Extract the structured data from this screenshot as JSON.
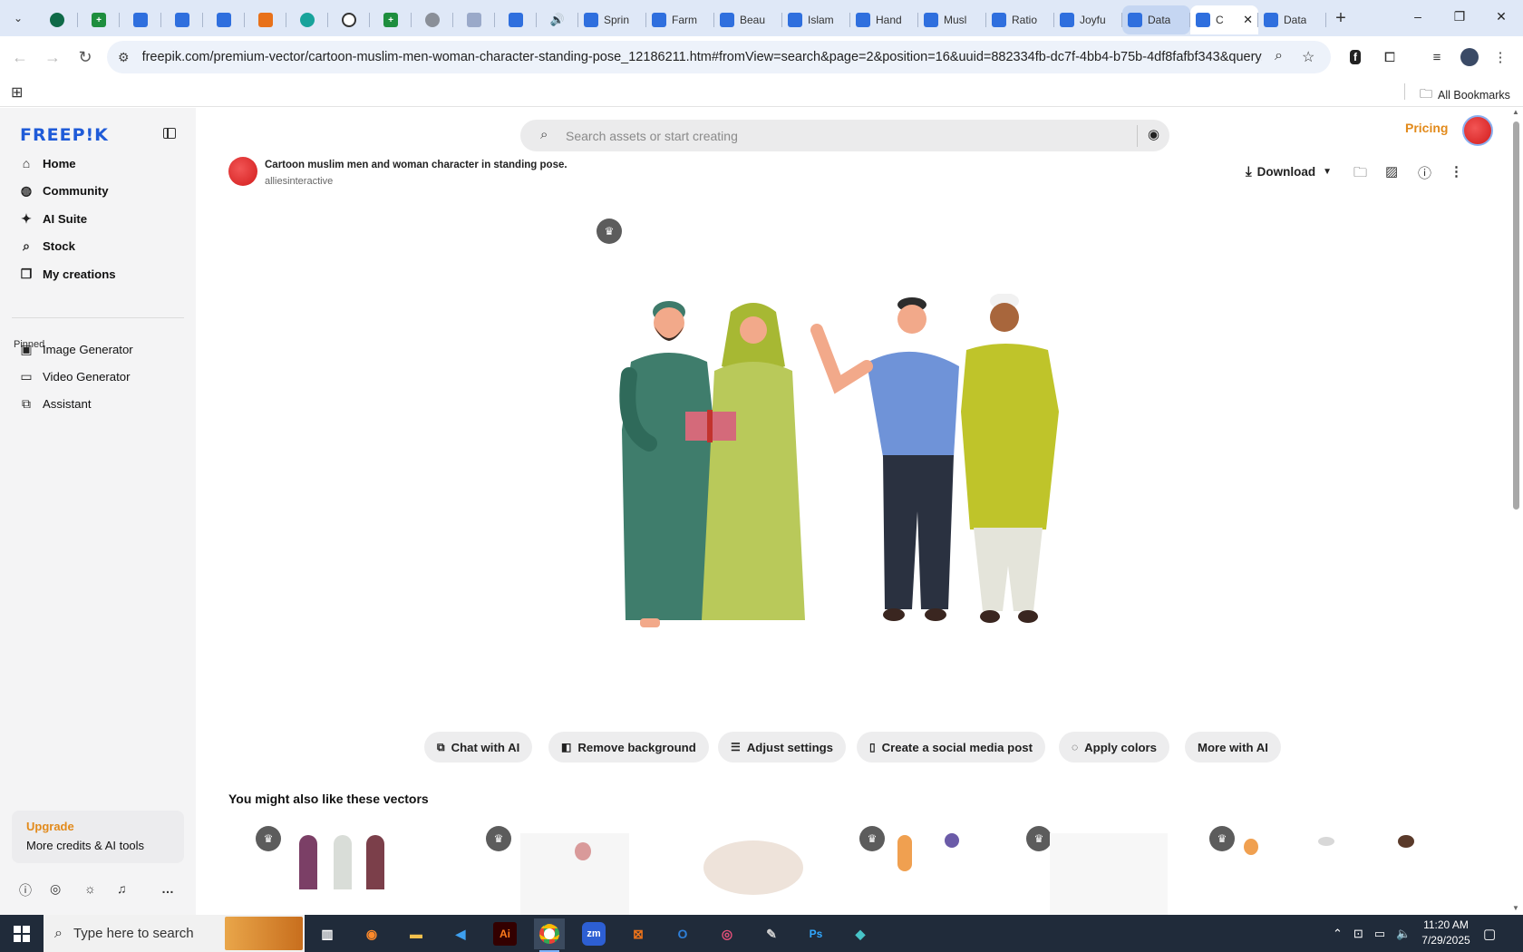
{
  "browser": {
    "tabs": [
      {
        "kind": "pinned",
        "icon": "vpn"
      },
      {
        "kind": "pinned",
        "icon": "sheets"
      },
      {
        "kind": "pinned",
        "icon": "docs"
      },
      {
        "kind": "pinned",
        "icon": "docs"
      },
      {
        "kind": "pinned",
        "icon": "docs"
      },
      {
        "kind": "pinned",
        "icon": "orange"
      },
      {
        "kind": "pinned",
        "icon": "teal"
      },
      {
        "kind": "pinned",
        "icon": "gpt"
      },
      {
        "kind": "pinned",
        "icon": "sheets"
      },
      {
        "kind": "pinned",
        "icon": "globe"
      },
      {
        "kind": "pinned",
        "icon": "qr"
      },
      {
        "kind": "pinned",
        "icon": "docs"
      },
      {
        "kind": "pinned",
        "icon": "spk"
      },
      {
        "kind": "titled",
        "icon": "docs",
        "label": "Sprin"
      },
      {
        "kind": "titled",
        "icon": "docs",
        "label": "Farm"
      },
      {
        "kind": "titled",
        "icon": "docs",
        "label": "Beau"
      },
      {
        "kind": "titled",
        "icon": "docs",
        "label": "Islam"
      },
      {
        "kind": "titled",
        "icon": "docs",
        "label": "Hand"
      },
      {
        "kind": "titled",
        "icon": "docs",
        "label": "Musl"
      },
      {
        "kind": "titled",
        "icon": "docs",
        "label": "Ratio"
      },
      {
        "kind": "titled",
        "icon": "docs",
        "label": "Joyfu"
      },
      {
        "kind": "titled",
        "icon": "docs",
        "label": "Data",
        "state": "highlight"
      },
      {
        "kind": "titled",
        "icon": "docs",
        "label": "C",
        "state": "active"
      },
      {
        "kind": "titled",
        "icon": "docs",
        "label": "Data"
      }
    ],
    "url": "freepik.com/premium-vector/cartoon-muslim-men-woman-character-standing-pose_12186211.htm#fromView=search&page=2&position=16&uuid=882334fb-dc7f-4bb4-b75b-4df8fafbf343&query...",
    "all_bookmarks": "All Bookmarks"
  },
  "sidebar": {
    "logo": "FREEP!K",
    "nav": [
      {
        "label": "Home",
        "icon": "home-icon",
        "glyph": "⌂"
      },
      {
        "label": "Community",
        "icon": "globe-icon",
        "glyph": "◍"
      },
      {
        "label": "AI Suite",
        "icon": "sparkle-icon",
        "glyph": "✦"
      },
      {
        "label": "Stock",
        "icon": "search-icon",
        "glyph": "⌕"
      },
      {
        "label": "My creations",
        "icon": "stack-icon",
        "glyph": "❐"
      }
    ],
    "pinned_label": "Pinned",
    "pinned": [
      {
        "label": "Image Generator",
        "icon": "image-icon",
        "glyph": "▣"
      },
      {
        "label": "Video Generator",
        "icon": "video-icon",
        "glyph": "▭"
      },
      {
        "label": "Assistant",
        "icon": "chat-icon",
        "glyph": "⧉"
      }
    ],
    "upgrade_title": "Upgrade",
    "upgrade_sub": "More credits & AI tools"
  },
  "header": {
    "search_placeholder": "Search assets or start creating",
    "pricing": "Pricing"
  },
  "asset": {
    "title": "Cartoon muslim men and woman character in standing pose.",
    "author": "alliesinteractive",
    "download_label": "Download"
  },
  "ai_actions": [
    {
      "label": "Chat with AI",
      "glyph": "⧉"
    },
    {
      "label": "Remove background",
      "glyph": "◧"
    },
    {
      "label": "Adjust settings",
      "glyph": "☰"
    },
    {
      "label": "Create a social media post",
      "glyph": "▯"
    },
    {
      "label": "Apply colors",
      "glyph": "◌"
    },
    {
      "label": "More with AI",
      "glyph": ""
    }
  ],
  "similar_title": "You might also like these vectors",
  "taskbar": {
    "search_placeholder": "Type here to search",
    "time": "11:20 AM",
    "date": "7/29/2025"
  },
  "colors": {
    "brand_blue": "#1f5bd8",
    "accent_orange": "#e28a1b",
    "taskbar_bg": "#202b3a",
    "tab_bar_bg": "#dfe8f7"
  }
}
